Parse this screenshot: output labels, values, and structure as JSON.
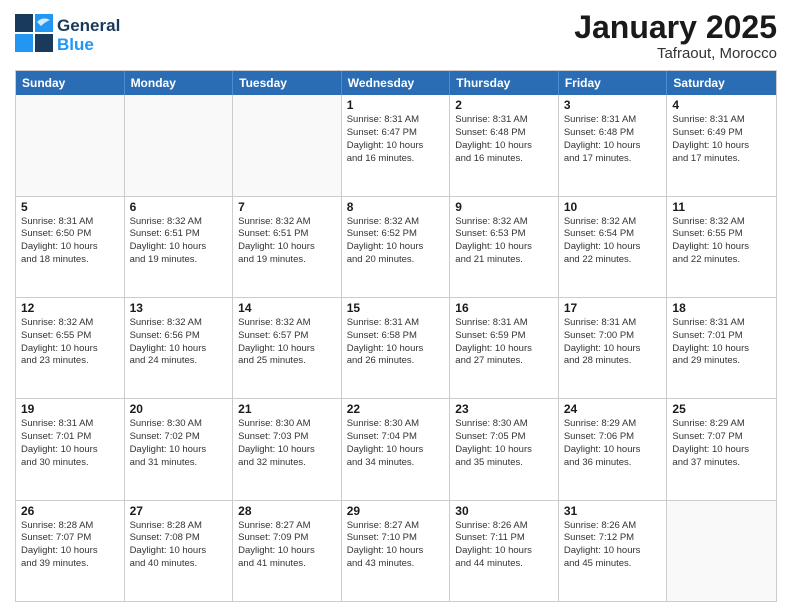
{
  "header": {
    "logo_general": "General",
    "logo_blue": "Blue",
    "month_title": "January 2025",
    "location": "Tafraout, Morocco"
  },
  "days_of_week": [
    "Sunday",
    "Monday",
    "Tuesday",
    "Wednesday",
    "Thursday",
    "Friday",
    "Saturday"
  ],
  "weeks": [
    [
      {
        "num": "",
        "info": ""
      },
      {
        "num": "",
        "info": ""
      },
      {
        "num": "",
        "info": ""
      },
      {
        "num": "1",
        "info": "Sunrise: 8:31 AM\nSunset: 6:47 PM\nDaylight: 10 hours\nand 16 minutes."
      },
      {
        "num": "2",
        "info": "Sunrise: 8:31 AM\nSunset: 6:48 PM\nDaylight: 10 hours\nand 16 minutes."
      },
      {
        "num": "3",
        "info": "Sunrise: 8:31 AM\nSunset: 6:48 PM\nDaylight: 10 hours\nand 17 minutes."
      },
      {
        "num": "4",
        "info": "Sunrise: 8:31 AM\nSunset: 6:49 PM\nDaylight: 10 hours\nand 17 minutes."
      }
    ],
    [
      {
        "num": "5",
        "info": "Sunrise: 8:31 AM\nSunset: 6:50 PM\nDaylight: 10 hours\nand 18 minutes."
      },
      {
        "num": "6",
        "info": "Sunrise: 8:32 AM\nSunset: 6:51 PM\nDaylight: 10 hours\nand 19 minutes."
      },
      {
        "num": "7",
        "info": "Sunrise: 8:32 AM\nSunset: 6:51 PM\nDaylight: 10 hours\nand 19 minutes."
      },
      {
        "num": "8",
        "info": "Sunrise: 8:32 AM\nSunset: 6:52 PM\nDaylight: 10 hours\nand 20 minutes."
      },
      {
        "num": "9",
        "info": "Sunrise: 8:32 AM\nSunset: 6:53 PM\nDaylight: 10 hours\nand 21 minutes."
      },
      {
        "num": "10",
        "info": "Sunrise: 8:32 AM\nSunset: 6:54 PM\nDaylight: 10 hours\nand 22 minutes."
      },
      {
        "num": "11",
        "info": "Sunrise: 8:32 AM\nSunset: 6:55 PM\nDaylight: 10 hours\nand 22 minutes."
      }
    ],
    [
      {
        "num": "12",
        "info": "Sunrise: 8:32 AM\nSunset: 6:55 PM\nDaylight: 10 hours\nand 23 minutes."
      },
      {
        "num": "13",
        "info": "Sunrise: 8:32 AM\nSunset: 6:56 PM\nDaylight: 10 hours\nand 24 minutes."
      },
      {
        "num": "14",
        "info": "Sunrise: 8:32 AM\nSunset: 6:57 PM\nDaylight: 10 hours\nand 25 minutes."
      },
      {
        "num": "15",
        "info": "Sunrise: 8:31 AM\nSunset: 6:58 PM\nDaylight: 10 hours\nand 26 minutes."
      },
      {
        "num": "16",
        "info": "Sunrise: 8:31 AM\nSunset: 6:59 PM\nDaylight: 10 hours\nand 27 minutes."
      },
      {
        "num": "17",
        "info": "Sunrise: 8:31 AM\nSunset: 7:00 PM\nDaylight: 10 hours\nand 28 minutes."
      },
      {
        "num": "18",
        "info": "Sunrise: 8:31 AM\nSunset: 7:01 PM\nDaylight: 10 hours\nand 29 minutes."
      }
    ],
    [
      {
        "num": "19",
        "info": "Sunrise: 8:31 AM\nSunset: 7:01 PM\nDaylight: 10 hours\nand 30 minutes."
      },
      {
        "num": "20",
        "info": "Sunrise: 8:30 AM\nSunset: 7:02 PM\nDaylight: 10 hours\nand 31 minutes."
      },
      {
        "num": "21",
        "info": "Sunrise: 8:30 AM\nSunset: 7:03 PM\nDaylight: 10 hours\nand 32 minutes."
      },
      {
        "num": "22",
        "info": "Sunrise: 8:30 AM\nSunset: 7:04 PM\nDaylight: 10 hours\nand 34 minutes."
      },
      {
        "num": "23",
        "info": "Sunrise: 8:30 AM\nSunset: 7:05 PM\nDaylight: 10 hours\nand 35 minutes."
      },
      {
        "num": "24",
        "info": "Sunrise: 8:29 AM\nSunset: 7:06 PM\nDaylight: 10 hours\nand 36 minutes."
      },
      {
        "num": "25",
        "info": "Sunrise: 8:29 AM\nSunset: 7:07 PM\nDaylight: 10 hours\nand 37 minutes."
      }
    ],
    [
      {
        "num": "26",
        "info": "Sunrise: 8:28 AM\nSunset: 7:07 PM\nDaylight: 10 hours\nand 39 minutes."
      },
      {
        "num": "27",
        "info": "Sunrise: 8:28 AM\nSunset: 7:08 PM\nDaylight: 10 hours\nand 40 minutes."
      },
      {
        "num": "28",
        "info": "Sunrise: 8:27 AM\nSunset: 7:09 PM\nDaylight: 10 hours\nand 41 minutes."
      },
      {
        "num": "29",
        "info": "Sunrise: 8:27 AM\nSunset: 7:10 PM\nDaylight: 10 hours\nand 43 minutes."
      },
      {
        "num": "30",
        "info": "Sunrise: 8:26 AM\nSunset: 7:11 PM\nDaylight: 10 hours\nand 44 minutes."
      },
      {
        "num": "31",
        "info": "Sunrise: 8:26 AM\nSunset: 7:12 PM\nDaylight: 10 hours\nand 45 minutes."
      },
      {
        "num": "",
        "info": ""
      }
    ]
  ]
}
